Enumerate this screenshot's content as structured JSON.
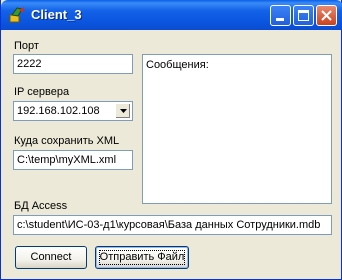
{
  "window": {
    "title": "Client_3",
    "app_icon": "borland-app-icon",
    "controls": {
      "minimize": "minimize-icon",
      "maximize": "maximize-icon",
      "close": "close-icon"
    }
  },
  "form": {
    "port_label": "Порт",
    "port_value": "2222",
    "ip_label": "IP сервера",
    "ip_value": "192.168.102.108",
    "xml_label": "Куда сохранить XML",
    "xml_value": "C:\\temp\\myXML.xml",
    "messages_text": "Сообщения:",
    "db_label": "БД Access",
    "db_value": "c:\\student\\ИС-03-д1\\курсовая\\База данных Сотрудники.mdb",
    "connect_label": "Connect",
    "send_label": "Отправить Файл"
  },
  "colors": {
    "titlebar": "#0A5FE7",
    "close_button": "#C9421F",
    "face": "#ECE9D8",
    "border": "#7F9DB9"
  }
}
